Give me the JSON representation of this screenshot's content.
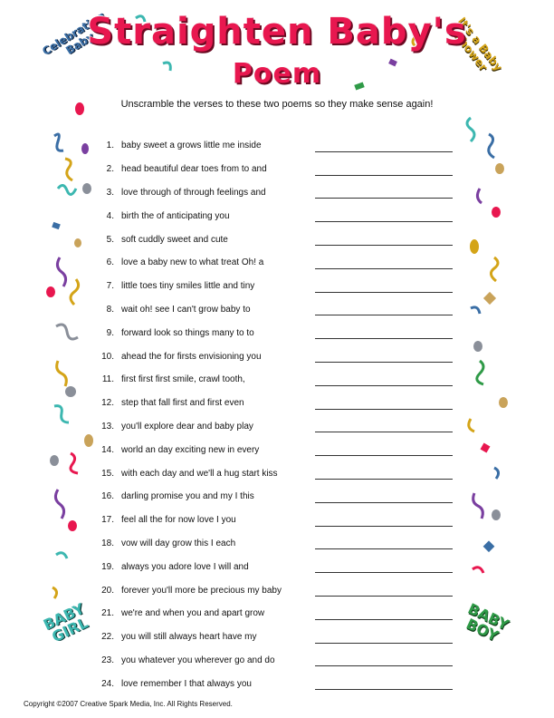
{
  "header": {
    "title_line1": "Straighten Baby's",
    "title_line2": "Poem",
    "badge_left": "Celebrating Baby",
    "badge_right": "It's a Baby Shower",
    "badge_bottom_left": "BABY GIRL",
    "badge_bottom_right": "BABY BOY"
  },
  "instructions": "Unscramble the verses to these two poems so they make sense again!",
  "items": [
    {
      "num": "1.",
      "text": "baby sweet a grows little me inside"
    },
    {
      "num": "2.",
      "text": "head beautiful dear toes from to and"
    },
    {
      "num": "3.",
      "text": "love through of through feelings and"
    },
    {
      "num": "4.",
      "text": "birth the of anticipating you"
    },
    {
      "num": "5.",
      "text": "soft cuddly sweet and cute"
    },
    {
      "num": "6.",
      "text": "love a baby new to what treat Oh! a"
    },
    {
      "num": "7.",
      "text": "little toes tiny smiles little and tiny"
    },
    {
      "num": "8.",
      "text": "wait oh! see I can't grow baby to"
    },
    {
      "num": "9.",
      "text": "forward look so things many to to"
    },
    {
      "num": "10.",
      "text": "ahead the for firsts envisioning you"
    },
    {
      "num": "11.",
      "text": "first first first smile, crawl tooth,"
    },
    {
      "num": "12.",
      "text": "step that fall first and first even"
    },
    {
      "num": "13.",
      "text": "you'll explore dear and baby play"
    },
    {
      "num": "14.",
      "text": "world an day exciting new in every"
    },
    {
      "num": "15.",
      "text": "with each day and we'll a hug start kiss"
    },
    {
      "num": "16.",
      "text": "darling promise you and my I this"
    },
    {
      "num": "17.",
      "text": "feel all the for now love I you"
    },
    {
      "num": "18.",
      "text": "vow will day grow this I each"
    },
    {
      "num": "19.",
      "text": "always you adore love I will and"
    },
    {
      "num": "20.",
      "text": "forever you'll more be precious my baby"
    },
    {
      "num": "21.",
      "text": "we're and when you and apart grow"
    },
    {
      "num": "22.",
      "text": "you will still always heart have my"
    },
    {
      "num": "23.",
      "text": "you whatever you wherever go and do"
    },
    {
      "num": "24.",
      "text": "love remember I that always you"
    }
  ],
  "footer": {
    "copyright": "Copyright ©2007  Creative Spark Media, Inc.  All Rights Reserved."
  },
  "colors": {
    "title": "#e8174f",
    "confetti": [
      "#e8174f",
      "#3a6ea5",
      "#d4a418",
      "#7a3fa0",
      "#3cb7b0",
      "#2f9a47",
      "#c9a35a"
    ]
  },
  "decoration_icons": [
    "confetti-icon",
    "streamer-icon",
    "sparkle-icon"
  ]
}
